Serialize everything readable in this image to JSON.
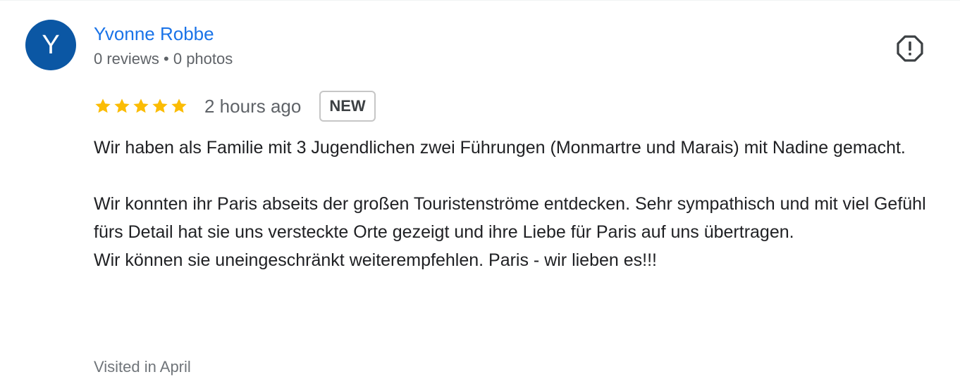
{
  "reviewer": {
    "initial": "Y",
    "avatar_color": "#0b57a4",
    "name": "Yvonne Robbe",
    "meta": "0 reviews • 0 photos"
  },
  "review": {
    "rating": 5,
    "star_color": "#fbbc04",
    "time_ago": "2 hours ago",
    "badge": "NEW",
    "paragraph_1": "Wir haben als Familie mit 3 Jugendlichen zwei Führungen (Monmartre und Marais) mit Nadine gemacht.",
    "paragraph_2": "Wir konnten ihr Paris abseits der großen Touristenströme entdecken. Sehr sympathisch und mit viel Gefühl fürs Detail hat sie uns versteckte Orte gezeigt und ihre Liebe für Paris auf uns übertragen.",
    "paragraph_3": "Wir können sie uneingeschränkt weiterempfehlen. Paris - wir lieben es!!!",
    "visited": "Visited in April"
  },
  "icons": {
    "report": "report-octagon-icon",
    "star": "star-icon"
  }
}
